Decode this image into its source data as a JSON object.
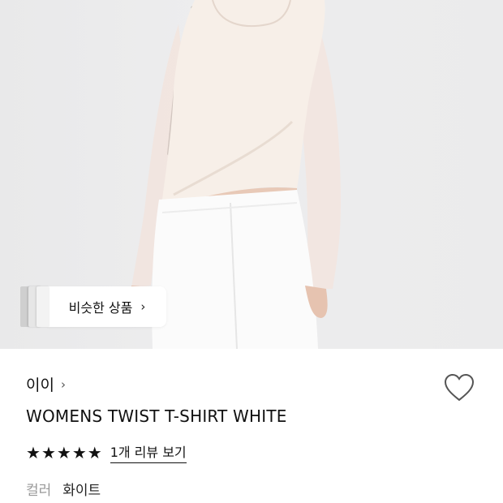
{
  "similar_products": {
    "label": "비슷한 상품",
    "chevron": "›"
  },
  "product": {
    "brand": "이이",
    "brand_chevron": "›",
    "name": "WOMENS TWIST T-SHIRT WHITE",
    "rating_stars": 5,
    "review_link": "1개 리뷰 보기",
    "color_label": "컬러",
    "color_value": "화이트"
  },
  "icons": {
    "wishlist": "heart-outline-icon",
    "stars": "star-filled-icon"
  },
  "colors": {
    "text": "#111111",
    "muted": "#999999",
    "background": "#ffffff"
  }
}
